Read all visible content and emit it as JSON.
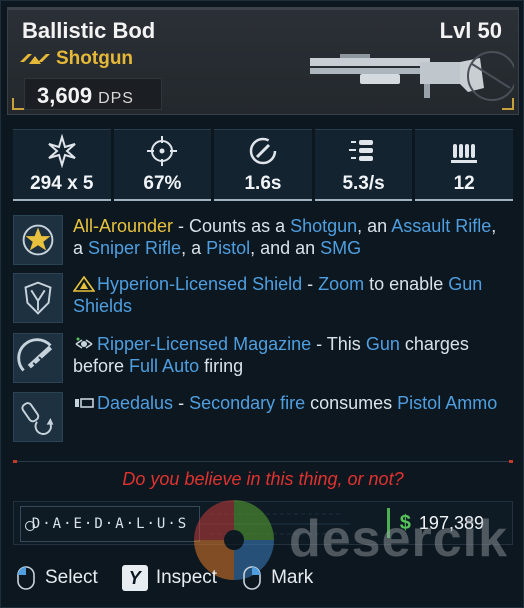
{
  "item": {
    "name": "Ballistic Bod",
    "level": "Lvl 50",
    "rarity": "Shotgun",
    "dps_value": "3,609",
    "dps_unit": "DPS"
  },
  "stats": [
    {
      "icon": "damage-burst-icon",
      "value": "294 x 5"
    },
    {
      "icon": "crosshair-accuracy-icon",
      "value": "67%"
    },
    {
      "icon": "reload-time-icon",
      "value": "1.6s"
    },
    {
      "icon": "fire-rate-bullets-icon",
      "value": "5.3/s"
    },
    {
      "icon": "magazine-icon",
      "value": "12"
    }
  ],
  "perks": [
    {
      "icon": "all-arounder-star-icon",
      "parts": [
        {
          "t": "All-Arounder",
          "c": "gold"
        },
        {
          "t": " - Counts as a ",
          "c": ""
        },
        {
          "t": "Shotgun",
          "c": "blue"
        },
        {
          "t": ", an ",
          "c": ""
        },
        {
          "t": "Assault Rifle",
          "c": "blue"
        },
        {
          "t": ", a ",
          "c": ""
        },
        {
          "t": "Sniper Rifle",
          "c": "blue"
        },
        {
          "t": ", a ",
          "c": ""
        },
        {
          "t": "Pistol",
          "c": "blue"
        },
        {
          "t": ", and an ",
          "c": ""
        },
        {
          "t": "SMG",
          "c": "blue"
        }
      ]
    },
    {
      "icon": "shield-emblem-icon",
      "inline_icon": "hyperion-icon",
      "parts": [
        {
          "t": "Hyperion-Licensed Shield",
          "c": "blue"
        },
        {
          "t": " - ",
          "c": ""
        },
        {
          "t": "Zoom",
          "c": "blue"
        },
        {
          "t": " to enable ",
          "c": ""
        },
        {
          "t": "Gun Shields",
          "c": "blue"
        }
      ]
    },
    {
      "icon": "charge-magazine-icon",
      "inline_icon": "ripper-icon",
      "parts": [
        {
          "t": "Ripper-Licensed Magazine",
          "c": "blue"
        },
        {
          "t": " - This ",
          "c": ""
        },
        {
          "t": "Gun",
          "c": "blue"
        },
        {
          "t": " charges before ",
          "c": ""
        },
        {
          "t": "Full Auto",
          "c": "blue"
        },
        {
          "t": " firing",
          "c": ""
        }
      ]
    },
    {
      "icon": "ammo-swap-icon",
      "inline_icon": "daedalus-icon",
      "parts": [
        {
          "t": "Daedalus",
          "c": "blue"
        },
        {
          "t": " - ",
          "c": ""
        },
        {
          "t": "Secondary fire",
          "c": "blue"
        },
        {
          "t": " consumes ",
          "c": ""
        },
        {
          "t": "Pistol Ammo",
          "c": "blue"
        }
      ]
    }
  ],
  "flavor_text": "Do you believe in this thing, or not?",
  "manufacturer": {
    "name": "D·A·E·D·A·L·U·S",
    "price_symbol": "$",
    "price": "197,389"
  },
  "watermark": "desercik",
  "controls": [
    {
      "icon": "mouse-left-icon",
      "label": "Select"
    },
    {
      "icon": "y-button-icon",
      "key": "Y",
      "label": "Inspect"
    },
    {
      "icon": "mouse-right-icon",
      "label": "Mark"
    }
  ],
  "colors": {
    "rarity_gold": "#e6b838",
    "highlight_blue": "#4f9fe0",
    "flavor_red": "#e0322f",
    "price_green": "#56c25a"
  }
}
